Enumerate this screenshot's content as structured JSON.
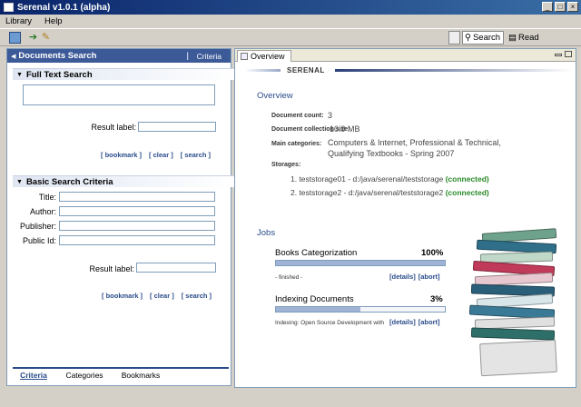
{
  "window": {
    "title": "Serenal v1.0.1 (alpha)"
  },
  "menu": {
    "items": [
      "Library",
      "Help"
    ]
  },
  "perspectives": {
    "search": "Search",
    "read": "Read"
  },
  "left_panel": {
    "title": "Documents Search",
    "header_link": "Criteria",
    "full_text": {
      "heading": "Full Text Search",
      "result_label": "Result label:",
      "links": [
        "[ bookmark ]",
        "[ clear ]",
        "[ search ]"
      ]
    },
    "basic": {
      "heading": "Basic Search Criteria",
      "fields": [
        "Title:",
        "Author:",
        "Publisher:",
        "Public Id:"
      ],
      "result_label": "Result label:",
      "links": [
        "[ bookmark ]",
        "[ clear ]",
        "[ search ]"
      ]
    },
    "tabs": [
      "Criteria",
      "Categories",
      "Bookmarks"
    ]
  },
  "right_panel": {
    "tab": "Overview",
    "brand": "SERENAL",
    "overview_heading": "Overview",
    "document_count_label": "Document count:",
    "document_count": "3",
    "collection_size_label": "Document collection size:",
    "collection_size": "10.9 MB",
    "main_categories_label": "Main categories:",
    "main_categories_line1": "Computers & Internet, Professional & Technical,",
    "main_categories_line2": "Qualifying Textbooks - Spring 2007",
    "storages_label": "Storages:",
    "storages": [
      {
        "text": "1. teststorage01 - d:/java/serenal/teststorage",
        "status": "(connected)"
      },
      {
        "text": "2. teststorage2 - d:/java/serenal/teststorage2",
        "status": "(connected)"
      }
    ],
    "jobs_heading": "Jobs",
    "jobs": [
      {
        "name": "Books Categorization",
        "percent": "100%",
        "progress": 1.0,
        "status": "- finished -",
        "links": [
          "[details]",
          "[abort]"
        ]
      },
      {
        "name": "Indexing Documents",
        "percent": "3%",
        "progress": 0.5,
        "status": "Indexing: Open Source Development with",
        "links": [
          "[details]",
          "[abort]"
        ]
      }
    ]
  },
  "colors": {
    "header_blue": "#3c5a98",
    "link_blue": "#2a4c8a",
    "connected_green": "#2a8a2a",
    "progress_fill": "#9fb3d6"
  }
}
